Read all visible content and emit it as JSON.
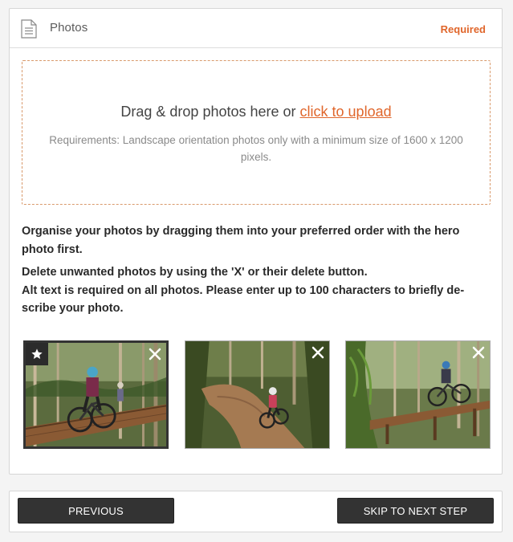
{
  "panel": {
    "title": "Photos",
    "required_label": "Required"
  },
  "dropzone": {
    "main_text": "Drag & drop photos here or ",
    "link_text": "click to upload",
    "requirements": "Requirements: Landscape orientation photos only with a minimum size of 1600 x 1200 pixels."
  },
  "instructions": {
    "line1": "Organise your photos by dragging them into your preferred order with the hero photo first.",
    "line2": "Delete unwanted photos by using the 'X' or their delete button.",
    "line3": "Alt text is required on all photos. Please enter up to 100 characters to briefly de-scribe your photo."
  },
  "photos": [
    {
      "hero": true,
      "icon": "star-icon",
      "delete_icon": "close-icon"
    },
    {
      "hero": false,
      "delete_icon": "close-icon"
    },
    {
      "hero": false,
      "delete_icon": "close-icon"
    }
  ],
  "footer": {
    "previous_label": "PREVIOUS",
    "next_label": "SKIP TO NEXT STEP"
  },
  "colors": {
    "accent": "#e0662b",
    "button_bg": "#333333"
  }
}
